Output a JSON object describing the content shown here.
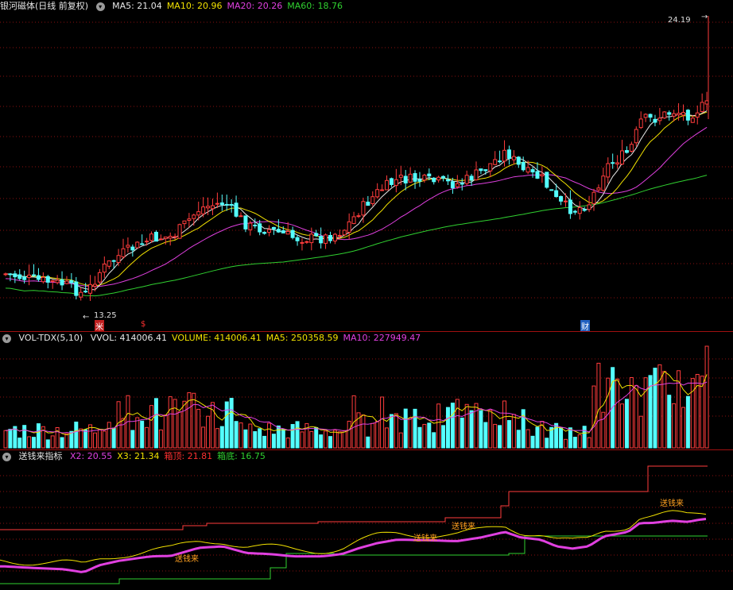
{
  "price_panel": {
    "stock_name": "银河磁体",
    "period": "(日线 前复权)",
    "ma_labels": [
      {
        "text": "MA5: 21.04",
        "color": "#e8e8e8"
      },
      {
        "text": "MA10: 20.96",
        "color": "#f0e000"
      },
      {
        "text": "MA20: 20.26",
        "color": "#e040e0"
      },
      {
        "text": "MA60: 18.76",
        "color": "#30d030"
      }
    ],
    "high_label": "24.19",
    "low_label": "13.25",
    "markers": [
      {
        "text": "米",
        "color": "#ffffff",
        "bg": "#c02020"
      },
      {
        "text": "$",
        "color": "#ff3030",
        "bg": "transparent"
      },
      {
        "text": "财",
        "color": "#ffffff",
        "bg": "#2060c0"
      }
    ]
  },
  "volume_panel": {
    "name": "VOL-TDX(5,10)",
    "labels": [
      {
        "text": "VVOL: 414006.41",
        "color": "#e8e8e8"
      },
      {
        "text": "VOLUME: 414006.41",
        "color": "#f0e000"
      },
      {
        "text": "MA5: 250358.59",
        "color": "#f0e000"
      },
      {
        "text": "MA10: 227949.47",
        "color": "#e040e0"
      }
    ]
  },
  "indicator_panel": {
    "name": "送钱来指标",
    "labels": [
      {
        "text": "X2: 20.55",
        "color": "#e040e0"
      },
      {
        "text": "X3: 21.34",
        "color": "#f0e000"
      },
      {
        "text": "箱顶: 21.81",
        "color": "#ff3030"
      },
      {
        "text": "箱底: 16.75",
        "color": "#30d030"
      }
    ],
    "signal_text": "送钱来",
    "signal_color": "#ffa020"
  },
  "colors": {
    "up": "#ff3c3c",
    "down": "#54ffff",
    "ma5": "#e8e8e8",
    "ma10": "#f0e000",
    "ma20": "#e040e0",
    "ma60": "#30d030",
    "grid": "#8a1010"
  },
  "chart_data": {
    "type": "candlestick",
    "summary": "Daily candlestick chart with MA lines, volume bars and a custom indicator",
    "price_high": 24.19,
    "price_low": 13.25
  }
}
